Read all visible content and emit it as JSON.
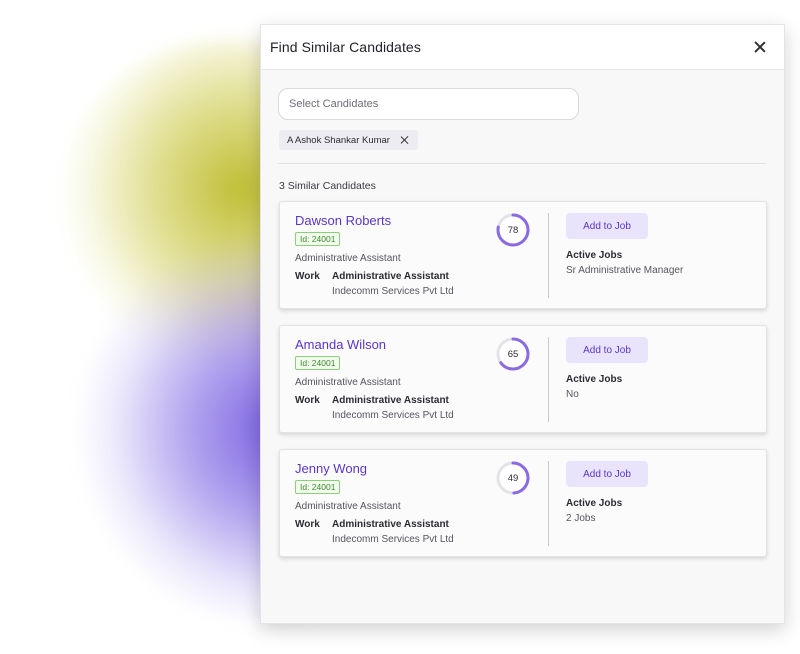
{
  "modal": {
    "title": "Find Similar Candidates",
    "search_placeholder": "Select Candidates",
    "selected_chip": "A Ashok Shankar Kumar",
    "results_label": "3 Similar Candidates"
  },
  "labels": {
    "work": "Work",
    "add_to_job": "Add to Job",
    "active_jobs": "Active Jobs"
  },
  "colors": {
    "accent": "#5a35c8",
    "score_ring": "#8a6be0",
    "score_track": "#e3e3e8",
    "id_badge": "#3d8a2b",
    "glow_yellow": "#bcba28",
    "glow_purple": "#7056de"
  },
  "candidates": [
    {
      "name": "Dawson Roberts",
      "id": "Id: 24001",
      "title": "Administrative Assistant",
      "work_role": "Administrative Assistant",
      "work_company": "Indecomm Services Pvt Ltd",
      "score": "78",
      "score_pct": 78,
      "active_jobs": "Sr Administrative Manager"
    },
    {
      "name": "Amanda Wilson",
      "id": "Id: 24001",
      "title": "Administrative Assistant",
      "work_role": "Administrative Assistant",
      "work_company": "Indecomm Services Pvt Ltd",
      "score": "65",
      "score_pct": 65,
      "active_jobs": "No"
    },
    {
      "name": "Jenny Wong",
      "id": "Id: 24001",
      "title": "Administrative Assistant",
      "work_role": "Administrative Assistant",
      "work_company": "Indecomm Services Pvt Ltd",
      "score": "49",
      "score_pct": 49,
      "active_jobs": "2 Jobs"
    }
  ]
}
